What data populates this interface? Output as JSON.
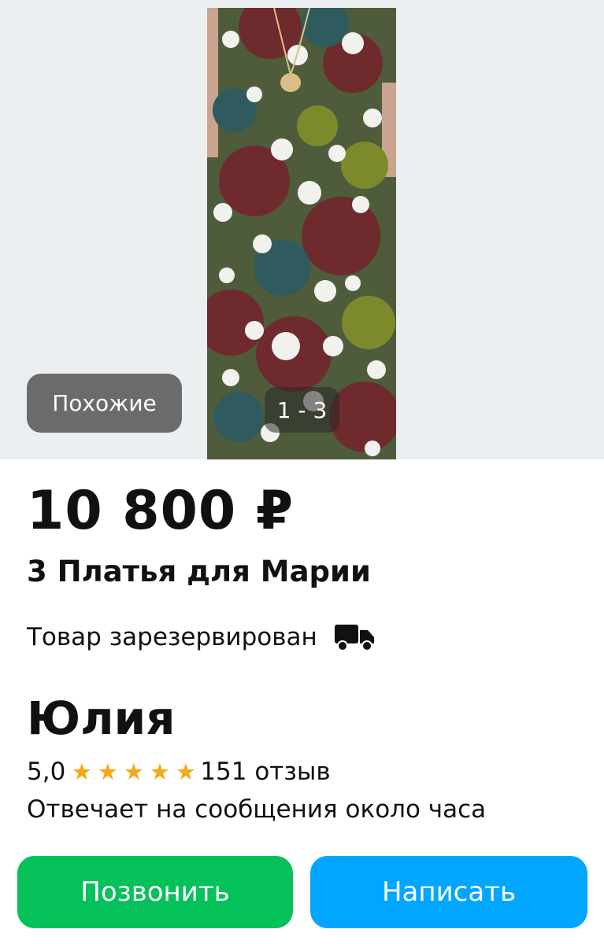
{
  "gallery": {
    "similar_label": "Похожие",
    "counter": "1 - 3"
  },
  "listing": {
    "price": "10 800 ₽",
    "title": "3 Платья для Марии",
    "status": "Товар зарезервирован",
    "status_icon": "delivery-truck-icon"
  },
  "seller": {
    "name": "Юлия",
    "rating": "5,0",
    "stars": 5,
    "reviews": "151 отзыв",
    "response_time": "Отвечает на сообщения около часа"
  },
  "actions": {
    "call_label": "Позвонить",
    "write_label": "Написать"
  },
  "colors": {
    "call_button": "#04c15a",
    "write_button": "#00a6ff",
    "star": "#f7a814",
    "dress_base": "#4e5c3c"
  }
}
